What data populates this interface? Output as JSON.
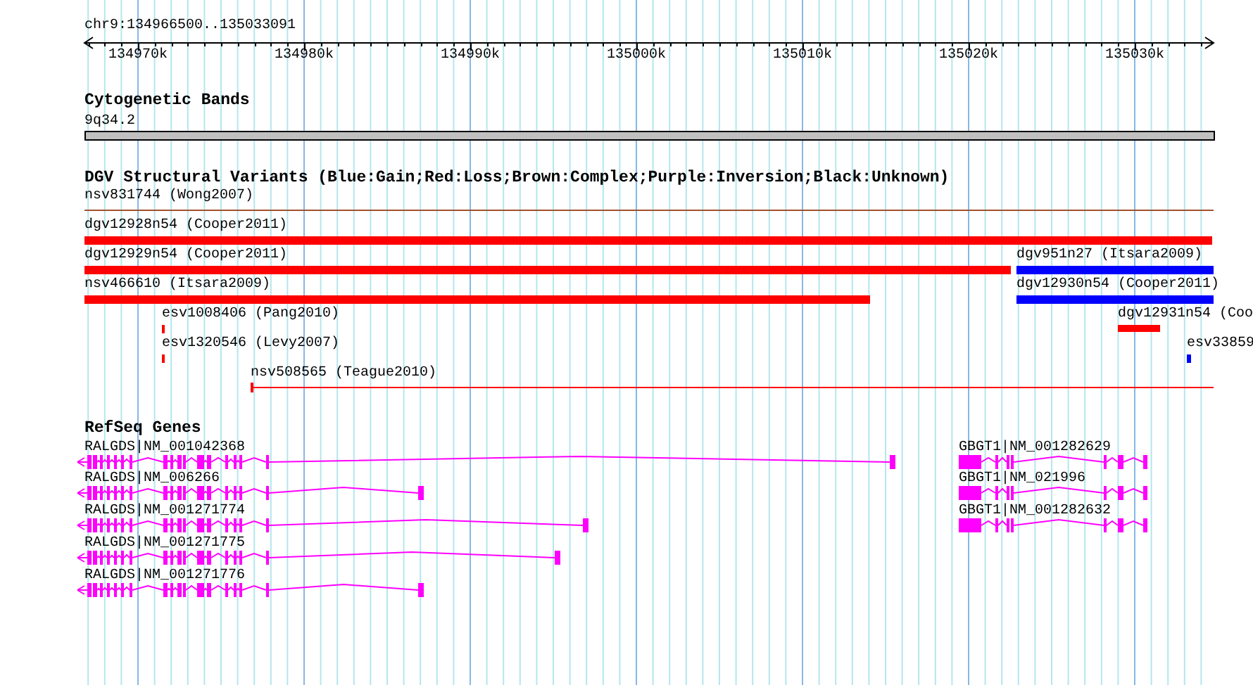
{
  "ruler": {
    "location": "chr9:134966500..135033091",
    "ticks": [
      "134970k",
      "134980k",
      "134990k",
      "135000k",
      "135010k",
      "135020k",
      "135030k"
    ]
  },
  "tracks": [
    {
      "kind": "bands",
      "title": "Cytogenetic Bands",
      "features": [
        {
          "label": "9q34.2"
        }
      ]
    },
    {
      "kind": "variants",
      "title": "DGV Structural Variants (Blue:Gain;Red:Loss;Brown:Complex;Purple:Inversion;Black:Unknown)",
      "features": [
        {
          "label": "nsv831744 (Wong2007)",
          "color": "#a0522d"
        },
        {
          "label": "dgv12928n54 (Cooper2011)",
          "color": "#ff0000"
        },
        {
          "label": "dgv12929n54 (Cooper2011)",
          "color": "#ff0000"
        },
        {
          "label": "dgv951n27 (Itsara2009)",
          "color": "#0000ff"
        },
        {
          "label": "nsv466610 (Itsara2009)",
          "color": "#ff0000"
        },
        {
          "label": "dgv12930n54 (Cooper2011)",
          "color": "#0000ff"
        },
        {
          "label": "esv1008406 (Pang2010)",
          "color": "#ff0000"
        },
        {
          "label": "dgv12931n54 (Coo",
          "color": "#ff0000"
        },
        {
          "label": "esv1320546 (Levy2007)",
          "color": "#ff0000"
        },
        {
          "label": "esv33859",
          "color": "#0000ff"
        },
        {
          "label": "nsv508565 (Teague2010)",
          "color": "#ff0000"
        }
      ]
    },
    {
      "kind": "genes",
      "title": "RefSeq Genes",
      "features": [
        {
          "label": "RALGDS|NM_001042368"
        },
        {
          "label": "GBGT1|NM_001282629"
        },
        {
          "label": "RALGDS|NM_006266"
        },
        {
          "label": "GBGT1|NM_021996"
        },
        {
          "label": "RALGDS|NM_001271774"
        },
        {
          "label": "GBGT1|NM_001282632"
        },
        {
          "label": "RALGDS|NM_001271775"
        },
        {
          "label": "RALGDS|NM_001271776"
        }
      ]
    }
  ]
}
